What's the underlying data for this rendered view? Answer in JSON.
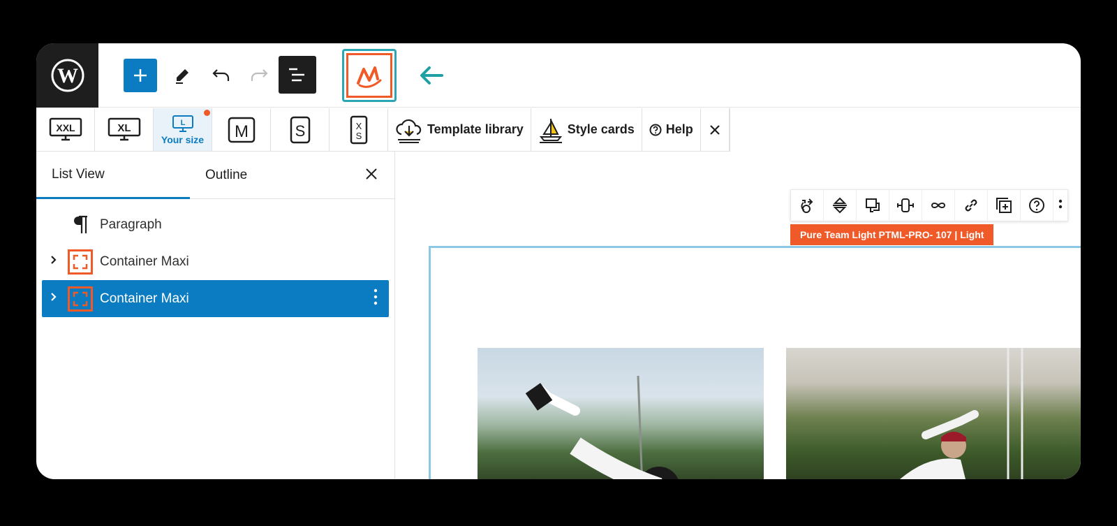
{
  "topbar": {
    "icons": [
      "wordpress-logo",
      "plus-icon",
      "pencil-icon",
      "undo-icon",
      "redo-icon",
      "list-view-icon",
      "maxi-logo",
      "arrow-left-icon"
    ]
  },
  "responsive": {
    "items": [
      {
        "id": "xxl",
        "text": "XXL"
      },
      {
        "id": "xl",
        "text": "XL"
      },
      {
        "id": "l",
        "text": "L",
        "label": "Your size"
      },
      {
        "id": "m",
        "text": "M"
      },
      {
        "id": "s",
        "text": "S"
      },
      {
        "id": "xs",
        "text": "XS"
      }
    ],
    "template_library": "Template library",
    "style_cards": "Style cards",
    "help": "Help"
  },
  "sidebar": {
    "tabs": [
      "List View",
      "Outline"
    ],
    "items": [
      {
        "label": "Paragraph",
        "icon": "paragraph-icon"
      },
      {
        "label": "Container Maxi",
        "icon": "container-icon"
      },
      {
        "label": "Container Maxi",
        "icon": "container-icon",
        "selected": true
      }
    ]
  },
  "canvas": {
    "block_tag": "Pure Team Light PTML-PRO- 107  | Light",
    "toolbar_icons": [
      "move-icon",
      "alignment-icon",
      "copy-style-icon",
      "size-icon",
      "loop-icon",
      "link-icon",
      "duplicate-icon",
      "help-icon",
      "more-icon"
    ]
  },
  "colors": {
    "accent": "#0b7cc1",
    "brand": "#f05a28",
    "teal": "#2aa6b5"
  }
}
